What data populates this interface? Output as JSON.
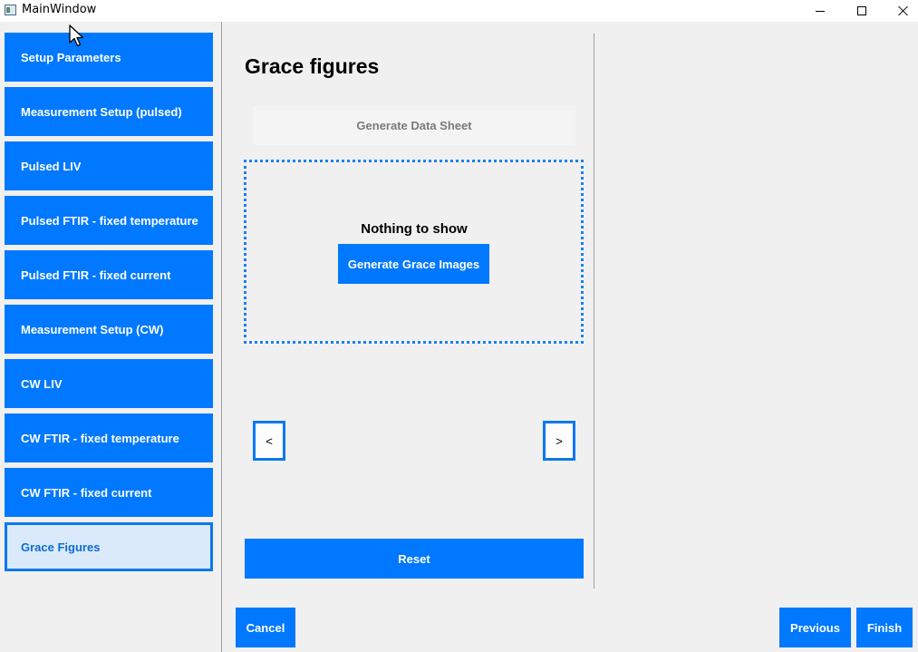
{
  "window": {
    "title": "MainWindow",
    "minimize_icon": "minimize-icon",
    "maximize_icon": "maximize-icon",
    "close_icon": "close-icon"
  },
  "sidebar": {
    "items": [
      {
        "label": "Setup Parameters",
        "active": false
      },
      {
        "label": "Measurement Setup (pulsed)",
        "active": false
      },
      {
        "label": "Pulsed LIV",
        "active": false
      },
      {
        "label": "Pulsed FTIR - fixed temperature",
        "active": false
      },
      {
        "label": "Pulsed FTIR - fixed current",
        "active": false
      },
      {
        "label": "Measurement Setup (CW)",
        "active": false
      },
      {
        "label": "CW LIV",
        "active": false
      },
      {
        "label": "CW FTIR - fixed temperature",
        "active": false
      },
      {
        "label": "CW FTIR - fixed current",
        "active": false
      },
      {
        "label": "Grace Figures",
        "active": true
      }
    ]
  },
  "main": {
    "title": "Grace figures",
    "generate_datasheet_label": "Generate Data Sheet",
    "empty_text": "Nothing to show",
    "generate_images_label": "Generate Grace Images",
    "prev_image_label": "<",
    "next_image_label": ">",
    "reset_label": "Reset"
  },
  "footer": {
    "cancel_label": "Cancel",
    "previous_label": "Previous",
    "finish_label": "Finish"
  },
  "colors": {
    "accent": "#0078ff",
    "active_bg": "#dbeafb",
    "disabled_text": "#7a7a7a",
    "background": "#f0f0f0"
  }
}
